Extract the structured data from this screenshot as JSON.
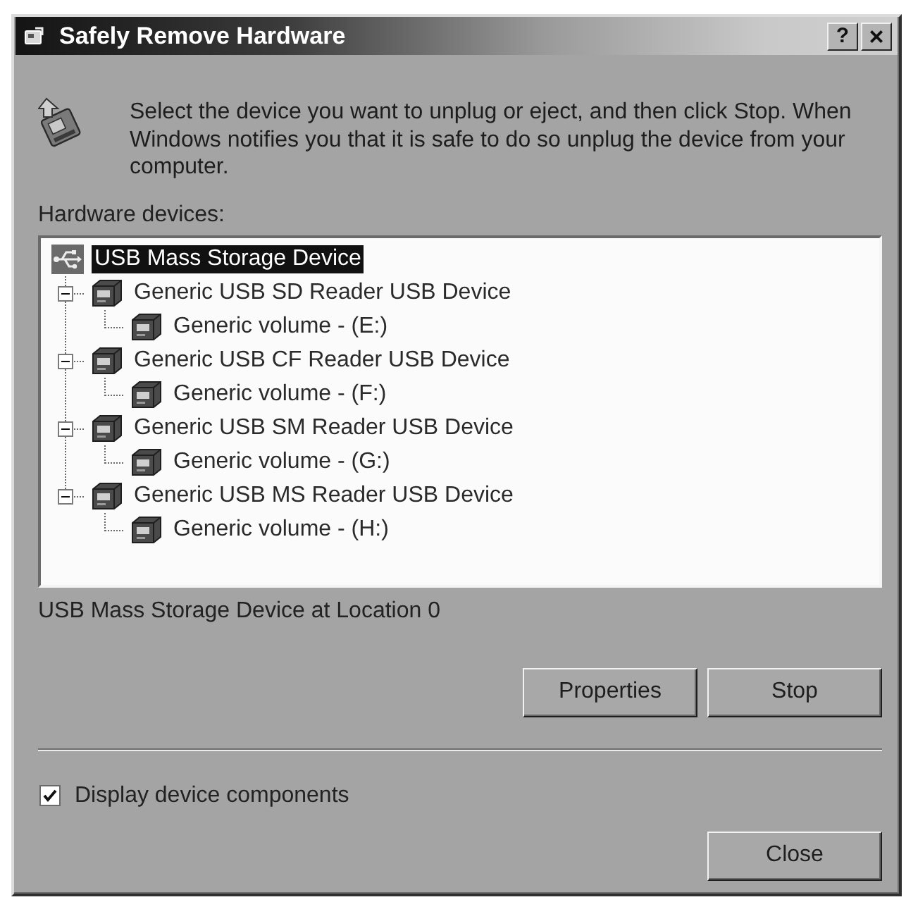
{
  "window": {
    "title": "Safely Remove Hardware",
    "buttons": [
      {
        "kind": "help",
        "glyph": "?"
      },
      {
        "kind": "close",
        "glyph": "×"
      }
    ]
  },
  "instructions": "Select the device you want to unplug or eject, and then click Stop. When Windows notifies you that it is safe to do so unplug the device from your computer.",
  "tree": {
    "label": "Hardware devices:",
    "items": [
      {
        "label": "USB Mass Storage Device",
        "selected": true,
        "children": [
          {
            "label": "Generic USB SD Reader USB Device",
            "selected": false,
            "expanded": true,
            "children": [
              {
                "label": "Generic volume - (E:)",
                "selected": false
              }
            ]
          },
          {
            "label": "Generic USB CF Reader USB Device",
            "selected": false,
            "expanded": true,
            "children": [
              {
                "label": "Generic volume - (F:)",
                "selected": false
              }
            ]
          },
          {
            "label": "Generic USB SM Reader USB Device",
            "selected": false,
            "expanded": true,
            "children": [
              {
                "label": "Generic volume - (G:)",
                "selected": false
              }
            ]
          },
          {
            "label": "Generic USB MS Reader USB Device",
            "selected": false,
            "expanded": true,
            "children": [
              {
                "label": "Generic volume - (H:)",
                "selected": false
              }
            ]
          }
        ]
      }
    ]
  },
  "status": "USB Mass Storage Device at Location 0",
  "action_buttons": [
    "Properties",
    "Stop"
  ],
  "option": {
    "label": "Display device components",
    "checked": true
  },
  "footer_buttons": [
    "Close"
  ]
}
